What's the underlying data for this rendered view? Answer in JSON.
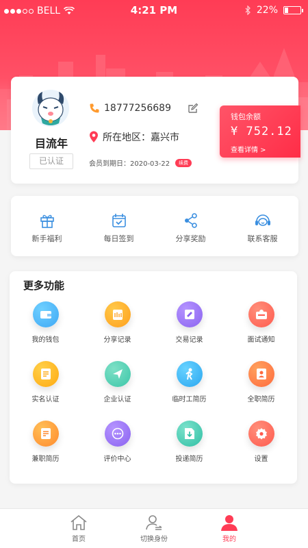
{
  "status_bar": {
    "carrier": "BELL",
    "time": "4:21 PM",
    "battery": "22%",
    "battery_level": 0.22
  },
  "profile": {
    "name": "目流年",
    "verified_label": "已认证",
    "phone": "18777256689",
    "location": "所在地区：嘉兴市",
    "member_expiry": "会员到期日：2020-03-22",
    "renew_label": "续费"
  },
  "wallet": {
    "title": "钱包余额",
    "amount": "¥ 752.12",
    "details_link": "查看详情 >"
  },
  "quick_actions": [
    {
      "label": "新手福利",
      "icon": "gift-icon"
    },
    {
      "label": "每日签到",
      "icon": "calendar-check-icon"
    },
    {
      "label": "分享奖励",
      "icon": "share-icon"
    },
    {
      "label": "联系客服",
      "icon": "headset-icon"
    }
  ],
  "more_functions": {
    "title": "更多功能",
    "items": [
      {
        "label": "我的钱包",
        "icon": "wallet-icon",
        "color": "#3fa8f5",
        "color2": "#6fd0ff"
      },
      {
        "label": "分享记录",
        "icon": "share-record-icon",
        "color": "#ff9f1c",
        "color2": "#ffc94a"
      },
      {
        "label": "交易记录",
        "icon": "transaction-icon",
        "color": "#8a63f0",
        "color2": "#b594ff"
      },
      {
        "label": "面试通知",
        "icon": "interview-icon",
        "color": "#ff5a4e",
        "color2": "#ff8f7a"
      },
      {
        "label": "实名认证",
        "icon": "id-verify-icon",
        "color": "#ffa90f",
        "color2": "#ffd04a"
      },
      {
        "label": "企业认证",
        "icon": "enterprise-verify-icon",
        "color": "#3bc6a8",
        "color2": "#7ee0c6"
      },
      {
        "label": "临时工简历",
        "icon": "temp-resume-icon",
        "color": "#2ba7f0",
        "color2": "#68d2ff"
      },
      {
        "label": "全职简历",
        "icon": "fulltime-resume-icon",
        "color": "#ff6a3d",
        "color2": "#ffa25e"
      },
      {
        "label": "兼职简历",
        "icon": "parttime-resume-icon",
        "color": "#ff8a2d",
        "color2": "#ffbf57"
      },
      {
        "label": "评价中心",
        "icon": "review-icon",
        "color": "#8a63f0",
        "color2": "#b594ff"
      },
      {
        "label": "投递简历",
        "icon": "submit-resume-icon",
        "color": "#2fbfa4",
        "color2": "#7de2cc"
      },
      {
        "label": "设置",
        "icon": "settings-icon",
        "color": "#ff5a4e",
        "color2": "#ff8f7a"
      }
    ]
  },
  "tabbar": {
    "items": [
      {
        "label": "首页",
        "icon": "home-icon",
        "active": false
      },
      {
        "label": "切换身份",
        "icon": "switch-identity-icon",
        "active": false
      },
      {
        "label": "我的",
        "icon": "profile-icon",
        "active": true
      }
    ]
  },
  "colors": {
    "accent": "#ff3c55",
    "quick_icon": "#3b8fe0"
  }
}
